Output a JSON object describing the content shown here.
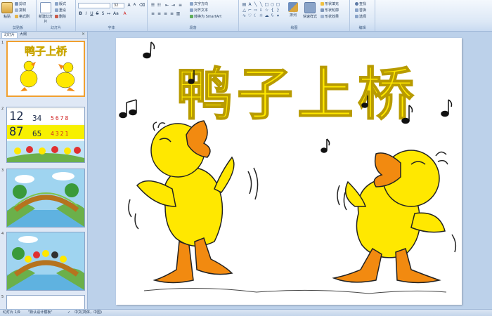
{
  "ribbon": {
    "clipboard": {
      "label": "剪贴板",
      "paste": "粘贴",
      "cut": "剪切",
      "copy": "复制",
      "format_painter": "格式刷"
    },
    "slides": {
      "label": "幻灯片",
      "new_slide": "新建幻灯片",
      "layout": "版式",
      "reset": "重设",
      "delete": "删除"
    },
    "font": {
      "label": "字体",
      "font_size": "32"
    },
    "paragraph": {
      "label": "段落",
      "text_direction": "文字方向",
      "align_text": "对齐文本",
      "smartart": "转换为 SmartArt"
    },
    "drawing": {
      "label": "绘图",
      "arrange": "排列",
      "quick_styles": "快速样式",
      "shape_fill": "形状填充",
      "shape_outline": "形状轮廓",
      "shape_effects": "形状效果"
    },
    "editing": {
      "label": "编辑",
      "find": "查找",
      "replace": "替换",
      "select": "选择"
    }
  },
  "panel": {
    "tab_slides": "幻灯片",
    "tab_outline": "大纲",
    "close": "×",
    "numbers": [
      "1",
      "2",
      "3",
      "4",
      "5"
    ]
  },
  "slide": {
    "title": "鸭子上桥"
  },
  "thumb2": {
    "row1_big": "12",
    "row1_small": "34",
    "row1_red": "5678",
    "row2_big": "87",
    "row2_small": "65",
    "row2_red": "4321"
  },
  "thumb_title": "鸭子上桥",
  "status": {
    "slide_count": "幻灯片 1/9",
    "theme": "\"默认设计模板\"",
    "language": "中文(简体，中国)"
  },
  "colors": {
    "ribbon": "#dce8f6",
    "panel": "#dfe8f5",
    "canvas": "#bcd1ea",
    "duck_yellow": "#ffe800",
    "duck_orange": "#f28a10",
    "selection": "#f0a030"
  }
}
